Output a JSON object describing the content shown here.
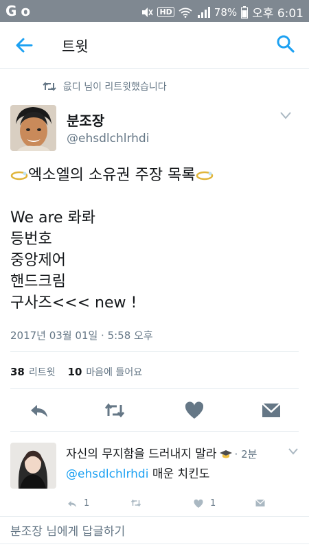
{
  "status_bar": {
    "left_icons": [
      "G",
      "o"
    ],
    "battery": "78%",
    "hd": "HD",
    "time": "오후 6:01"
  },
  "app_bar": {
    "title": "트윗"
  },
  "retweet_context": "읎디 님이 리트윗했습니다",
  "tweet": {
    "author_name": "분조장",
    "author_handle": "@ehsdlchlrhdi",
    "lines": [
      "엑소엘의 소유권 주장 목록",
      "",
      "We are 롸롸",
      "등번호",
      "중앙제어",
      "핸드크림",
      "구사즈<<< new !"
    ],
    "timestamp": "2017년 03월 01일 · 5:58 오후",
    "retweet_count": "38",
    "retweet_label": "리트윗",
    "like_count": "10",
    "like_label": "마음에 들어요"
  },
  "reply": {
    "text": "자신의 무지함을 드러내지 말라",
    "emoji": "graduation-cap",
    "time": "· 2분",
    "mention": "@ehsdlchlrhdi",
    "body": "매운 치킨도",
    "reply_count": "1",
    "like_count": "1"
  },
  "compose_placeholder": "분조장 님에게 답글하기",
  "colors": {
    "accent": "#1da1f2",
    "status_bar": "#7f8891",
    "secondary_text": "#657786"
  }
}
